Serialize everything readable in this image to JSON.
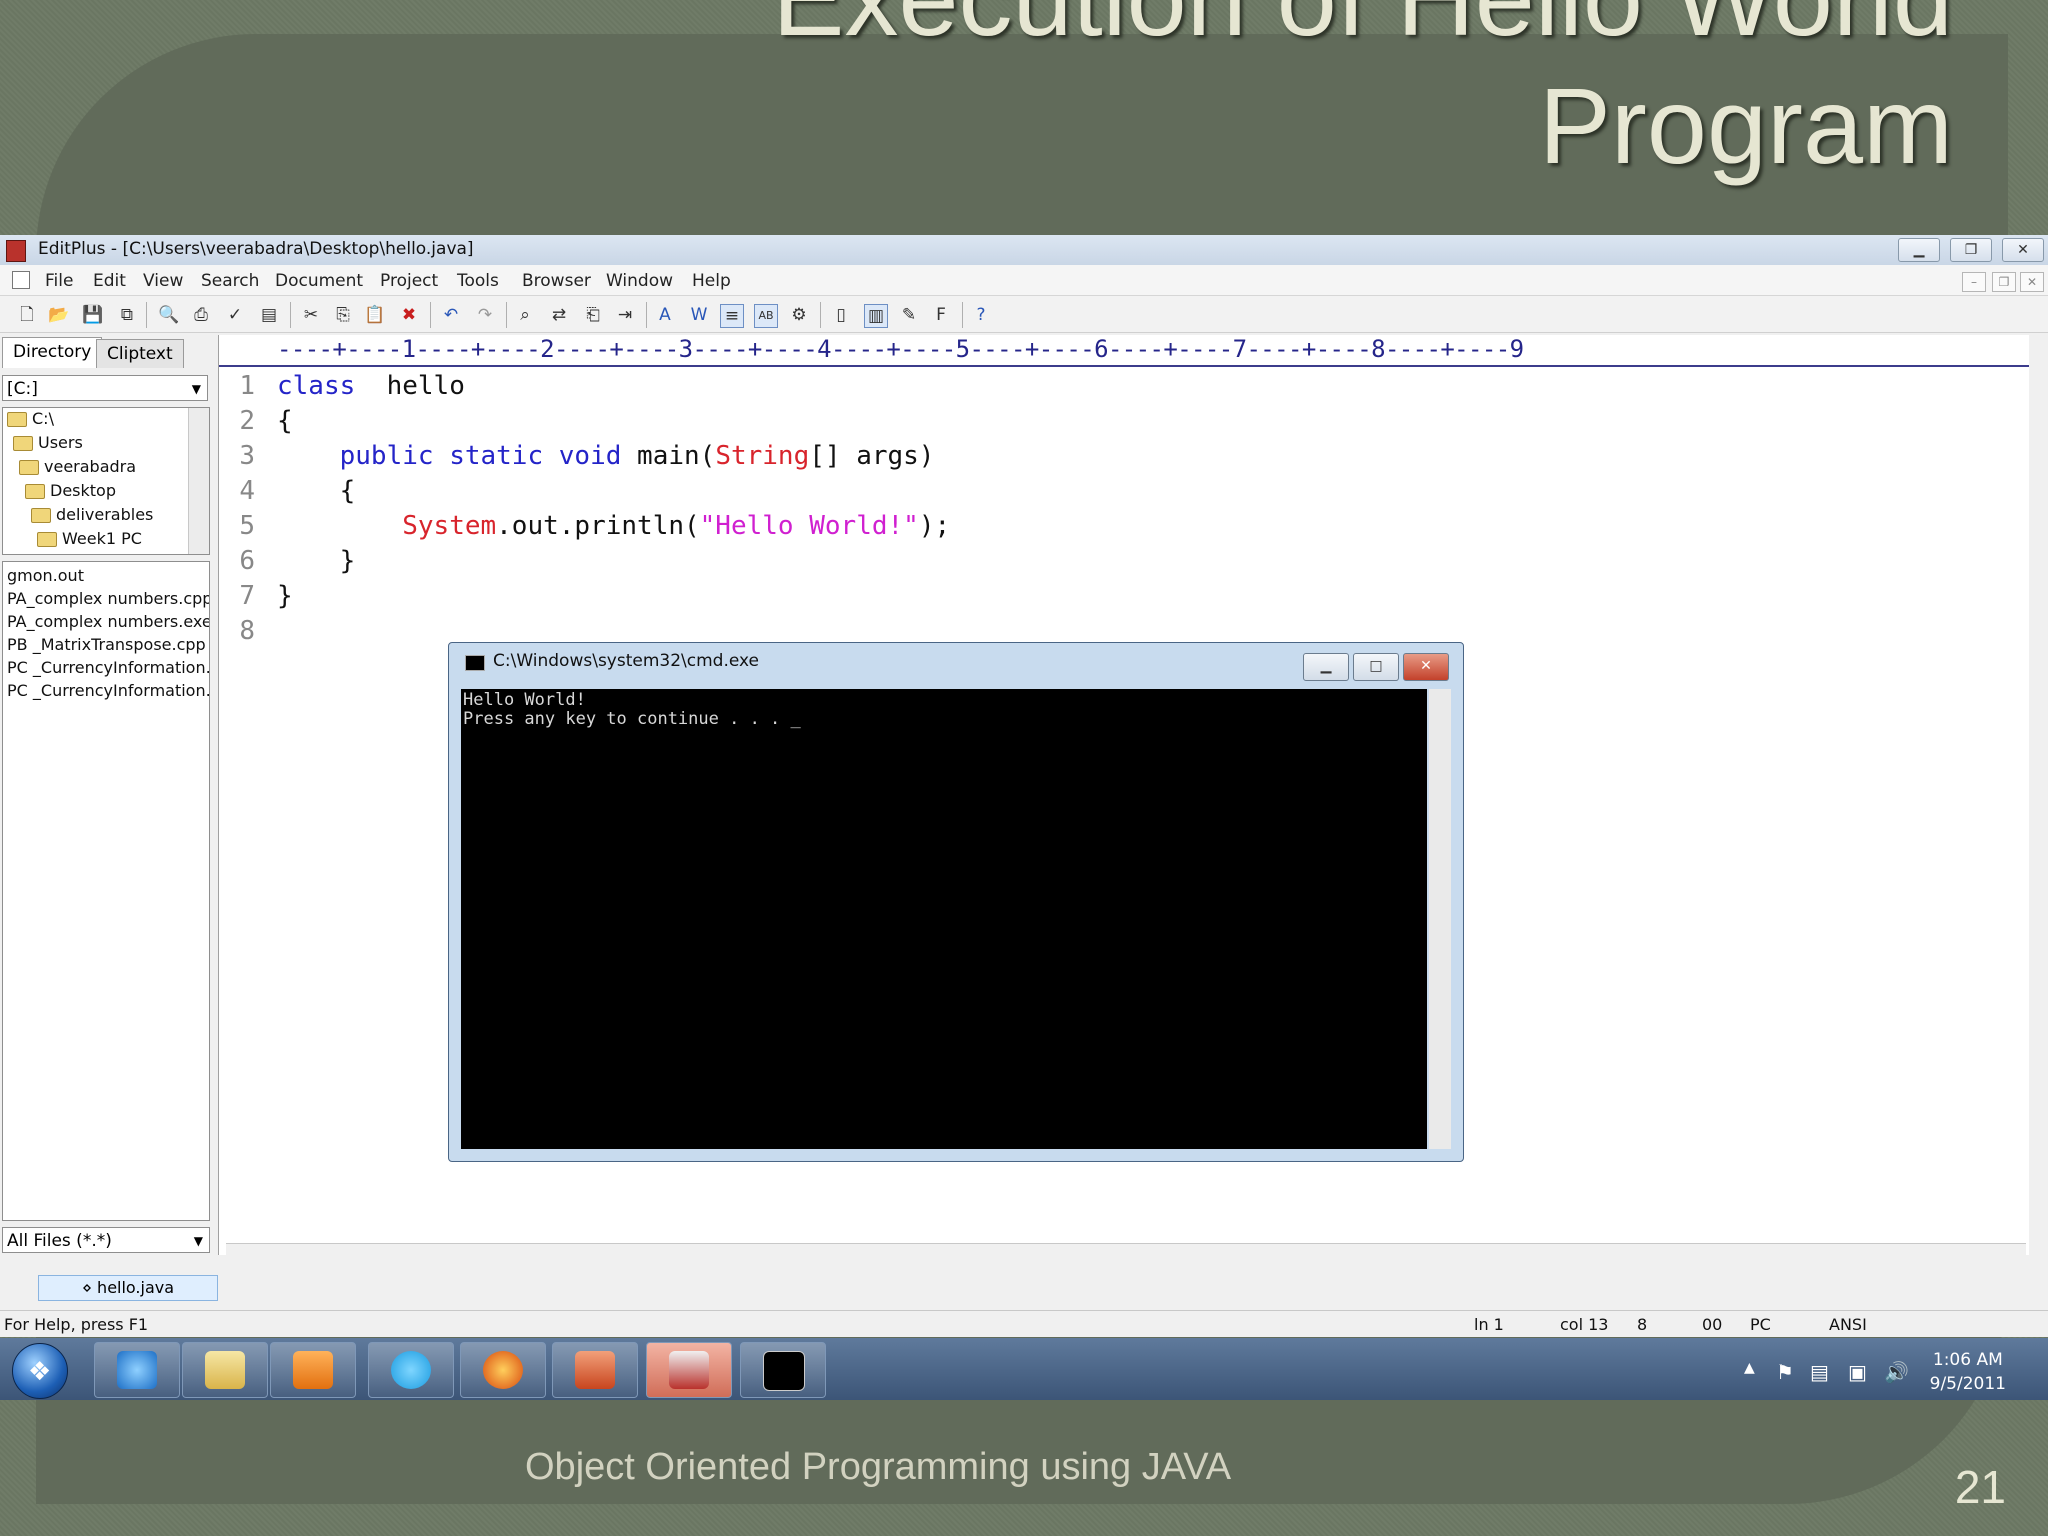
{
  "slide": {
    "title_line1": "Execution of Hello World",
    "title_line2": "Program",
    "footer": "Object Oriented Programming using JAVA",
    "page_number": "21"
  },
  "editplus": {
    "window_title": "EditPlus - [C:\\Users\\veerabadra\\Desktop\\hello.java]",
    "menu": [
      "File",
      "Edit",
      "View",
      "Search",
      "Document",
      "Project",
      "Tools",
      "Browser",
      "Window",
      "Help"
    ],
    "panel_tabs": [
      "Directory",
      "Cliptext"
    ],
    "drive": "[C:]",
    "tree": [
      "C:\\",
      "Users",
      "veerabadra",
      "Desktop",
      "deliverables",
      "Week1 PC"
    ],
    "files": [
      "gmon.out",
      "PA_complex numbers.cpp",
      "PA_complex numbers.exe",
      "PB _MatrixTranspose.cpp",
      "PC _CurrencyInformation.",
      "PC _CurrencyInformation."
    ],
    "filter": "All Files (*.*)",
    "ruler": "----+----1----+----2----+----3----+----4----+----5----+----6----+----7----+----8----+----9",
    "line_numbers": [
      "1",
      "2",
      "3",
      "4",
      "5",
      "6",
      "7",
      "8"
    ],
    "code": {
      "l1_kw": "class",
      "l1_rest": "  hello",
      "l2": "{",
      "l3_indent": "    ",
      "l3_kw": "public static void",
      "l3_mid": " main(",
      "l3_type": "String",
      "l3_rest": "[] args)",
      "l4": "    {",
      "l5_indent": "        ",
      "l5_type": "System",
      "l5_mid": ".out.println(",
      "l5_str": "\"Hello World!\"",
      "l5_end": ");",
      "l6": "    }",
      "l7": "}"
    },
    "doc_tab": "hello.java",
    "status": {
      "help": "For Help, press F1",
      "ln": "ln 1",
      "col": "col 13",
      "n": "8",
      "code": "00",
      "mode": "PC",
      "encoding": "ANSI"
    }
  },
  "cmd": {
    "title": "C:\\Windows\\system32\\cmd.exe",
    "output_line1": "Hello World!",
    "output_line2": "Press any key to continue . . . _"
  },
  "taskbar": {
    "time": "1:06 AM",
    "date": "9/5/2011",
    "apps": [
      "internet-explorer-icon",
      "folder-icon",
      "media-player-icon",
      "skype-icon",
      "firefox-icon",
      "presentation-icon",
      "editplus-icon",
      "cmd-icon"
    ]
  }
}
